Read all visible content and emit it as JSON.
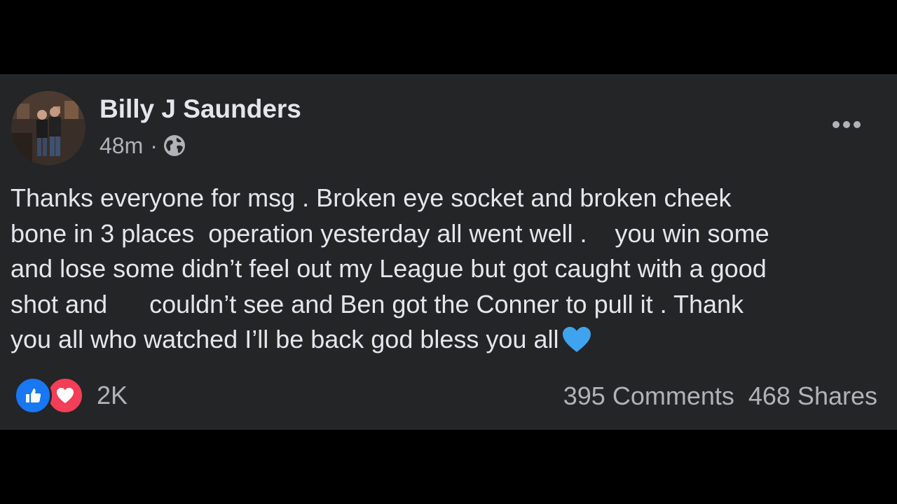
{
  "post": {
    "author": "Billy J Saunders",
    "time": "48m",
    "separator": "·",
    "privacy_icon": "globe-icon",
    "menu_icon": "more-options-icon",
    "body_lines": [
      "Thanks everyone for msg . Broken eye socket and broken cheek",
      "bone in 3 places  operation yesterday all went well .    you win some",
      "and lose some didn’t feel out my League but got caught with a good",
      "shot and      couldn’t see and Ben got the Conner to pull it . Thank",
      "you all who watched I’ll be back god bless you all"
    ],
    "body_emoji": "blue-heart-emoji"
  },
  "reactions": {
    "icons": [
      "like-icon",
      "love-icon"
    ],
    "count": "2K"
  },
  "stats": {
    "comments": "395 Comments",
    "shares": "468 Shares"
  },
  "colors": {
    "page_background": "#000000",
    "card_background": "#242526",
    "primary_text": "#e4e6eb",
    "secondary_text": "#b0b3b8",
    "like_blue": "#1877f2",
    "love_red": "#f33e58",
    "heart_blue": "#3ea4f0"
  }
}
